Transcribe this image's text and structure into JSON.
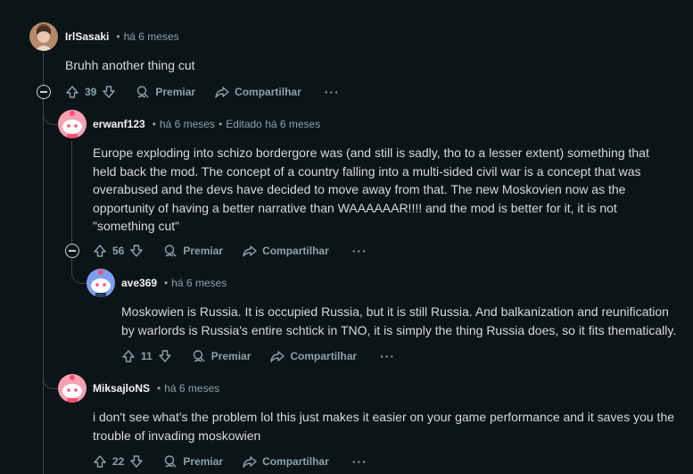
{
  "comments": [
    {
      "user": "IrlSasaki",
      "time": "há 6 meses",
      "edited": "",
      "body": "Bruhh another thing cut",
      "votes": "39",
      "award_label": "Premiar",
      "share_label": "Compartilhar",
      "more_label": "···",
      "avatar_icon": "photo-avatar-icon"
    },
    {
      "user": "erwanf123",
      "time": "há 6 meses",
      "edited": "Editado há 6 meses",
      "body": "Europe exploding into schizo bordergore was (and still is sadly, tho to a lesser extent) something that held back the mod. The concept of a country falling into a multi-sided civil war is a concept that was overabused and the devs have decided to move away from that. The new Moskovien now as the opportunity of having a better narrative than WAAAAAAR!!!! and the mod is better for it, it is not \"something cut\"",
      "votes": "56",
      "award_label": "Premiar",
      "share_label": "Compartilhar",
      "more_label": "···",
      "avatar_icon": "snoo-pink-icon"
    },
    {
      "user": "ave369",
      "time": "há 6 meses",
      "edited": "",
      "body": "Moskowien is Russia. It is occupied Russia, but it is still Russia. And balkanization and reunification by warlords is Russia's entire schtick in TNO, it is simply the thing Russia does, so it fits thematically.",
      "votes": "11",
      "award_label": "Premiar",
      "share_label": "Compartilhar",
      "more_label": "···",
      "avatar_icon": "snoo-blue-icon"
    },
    {
      "user": "MiksajloNS",
      "time": "há 6 meses",
      "edited": "",
      "body": "i don't see what's the problem lol this just makes it easier on your game performance and it saves you the trouble of invading moskowien",
      "votes": "22",
      "award_label": "Premiar",
      "share_label": "Compartilhar",
      "more_label": "···",
      "avatar_icon": "snoo-pink-icon"
    }
  ],
  "colors": {
    "background": "#0b1416",
    "text": "#d7dadc",
    "meta": "#8ba2ad",
    "thread_line": "#33464c",
    "snoo_pink": "#f4a1b5",
    "snoo_blue": "#7d9ff2"
  }
}
